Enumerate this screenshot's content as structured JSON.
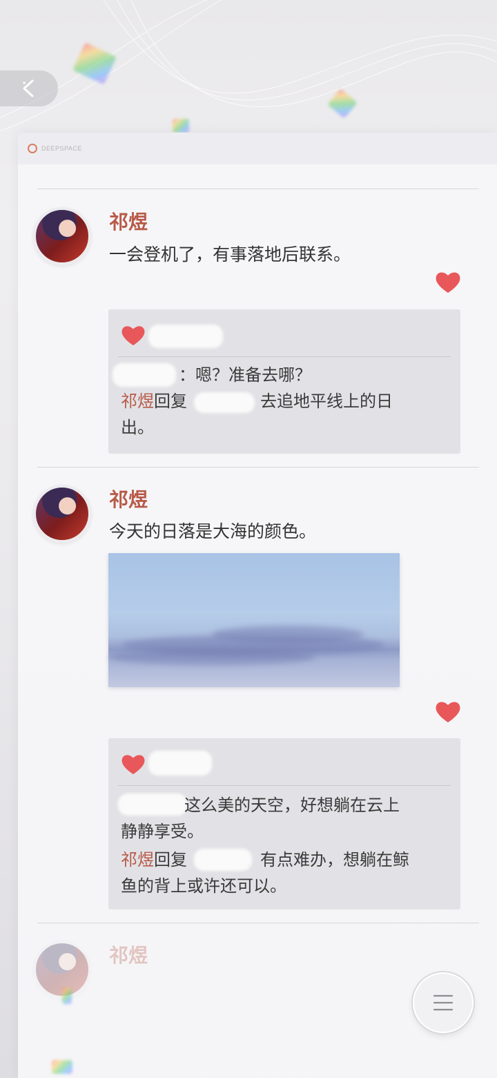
{
  "brand": {
    "text": "DEEPSPACE"
  },
  "posts": [
    {
      "author": "祁煜",
      "text": "一会登机了，有事落地后联系。",
      "comments": {
        "line1_suffix": "：嗯？准备去哪？",
        "reply_author": "祁煜",
        "reply_word": "回复",
        "reply_text_1": "：去追地平线上的日",
        "reply_text_2": "出。"
      }
    },
    {
      "author": "祁煜",
      "text": "今天的日落是大海的颜色。",
      "comments": {
        "line1_suffix": " 这么美的天空，好想躺在云上",
        "line1_cont": "静静享受。",
        "reply_author": "祁煜",
        "reply_word": "回复",
        "reply_text_1": "：有点难办，想躺在鲸",
        "reply_text_2": "鱼的背上或许还可以。"
      }
    },
    {
      "author": "祁煜"
    }
  ],
  "colors": {
    "accent": "#b85a48",
    "heart": "#e8575a"
  },
  "icons": {
    "back": "chevron-left-icon",
    "menu": "hamburger-icon",
    "like": "heart-icon"
  }
}
